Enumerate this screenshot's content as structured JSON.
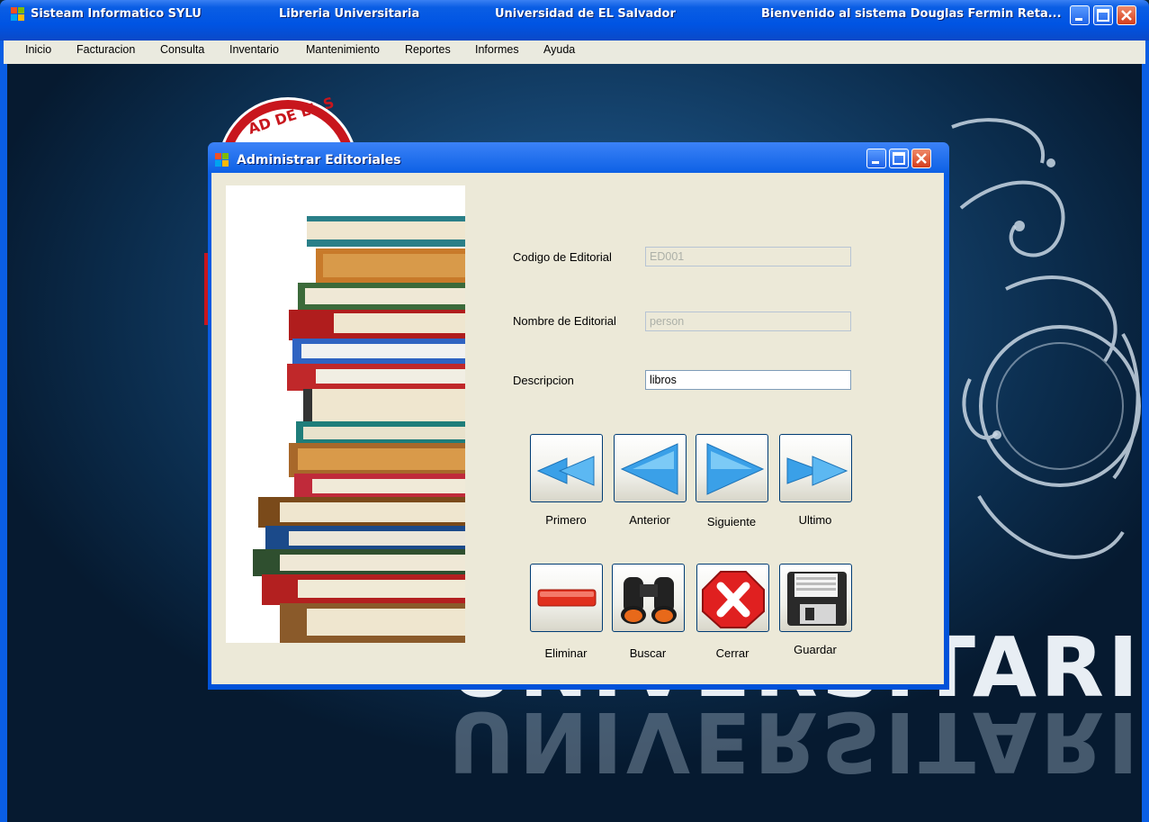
{
  "window": {
    "title_segments": [
      "Sisteam Informatico SYLU",
      "Libreria Universitaria",
      "Universidad de EL Salvador",
      "Bienvenido al sistema Douglas Fermin Reta..."
    ],
    "controls": [
      "minimize-icon",
      "maximize-icon",
      "close-icon"
    ]
  },
  "menu": [
    "Inicio",
    "Facturacion",
    "Consulta",
    "Inventario",
    "Mantenimiento",
    "Reportes",
    "Informes",
    "Ayuda"
  ],
  "desktop": {
    "seal_text": "AD DE EL S",
    "wordmark": "UNIVERSITARIA"
  },
  "dialog": {
    "title": "Administrar Editoriales",
    "form": {
      "codigo": {
        "label": "Codigo de Editorial",
        "value": "ED001",
        "enabled": false
      },
      "nombre": {
        "label": "Nombre de Editorial",
        "value": "person",
        "enabled": false
      },
      "descripcion": {
        "label": "Descripcion",
        "value": "libros",
        "enabled": true
      }
    },
    "nav_buttons": [
      {
        "label": "Primero",
        "icon": "first-arrow-icon"
      },
      {
        "label": "Anterior",
        "icon": "previous-arrow-icon"
      },
      {
        "label": "Siguiente",
        "icon": "next-arrow-icon"
      },
      {
        "label": "Ultimo",
        "icon": "last-arrow-icon"
      }
    ],
    "action_buttons": [
      {
        "label": "Eliminar",
        "icon": "delete-icon"
      },
      {
        "label": "Buscar",
        "icon": "binoculars-icon"
      },
      {
        "label": "Cerrar",
        "icon": "close-x-icon"
      },
      {
        "label": "Guardar",
        "icon": "floppy-disk-icon"
      }
    ]
  },
  "colors": {
    "titlebar": "#0054e3",
    "dialog_body": "#ece9d8",
    "close_button": "#d43d1c",
    "arrow_blue": "#3aa0e8"
  }
}
